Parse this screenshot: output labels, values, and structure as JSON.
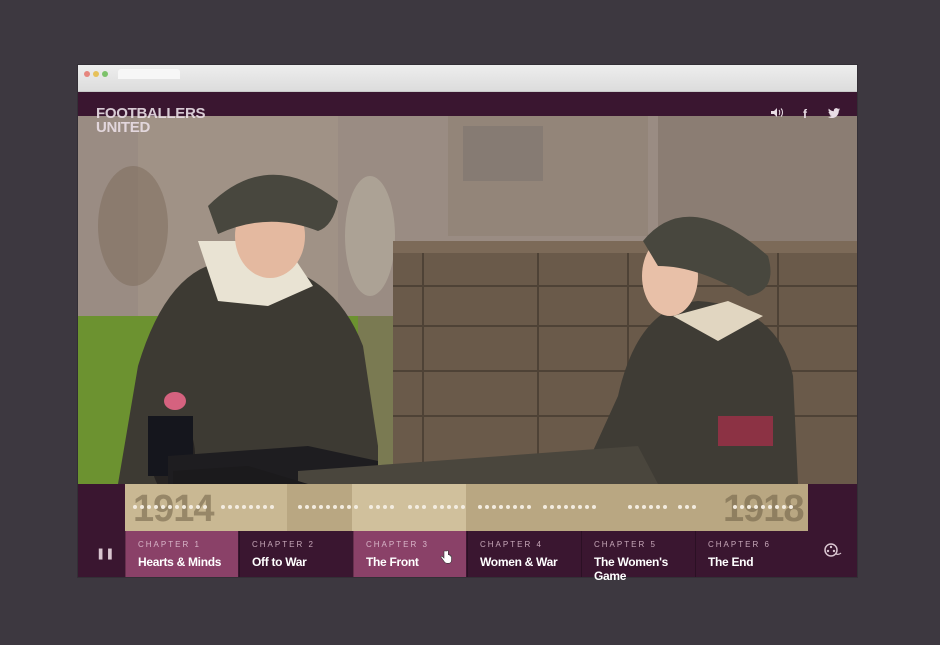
{
  "site": {
    "logo_line1": "FOOTBALLERS",
    "logo_line2": "UNITED"
  },
  "icons": {
    "sound": "speaker-icon",
    "facebook": "facebook-icon",
    "twitter": "twitter-icon",
    "pause": "pause-icon",
    "film": "film-reel-icon"
  },
  "timeline": {
    "start_year": "1914",
    "end_year": "1918"
  },
  "chapters": [
    {
      "num": "CHAPTER 1",
      "name": "Hearts & Minds"
    },
    {
      "num": "CHAPTER 2",
      "name": "Off to War"
    },
    {
      "num": "CHAPTER 3",
      "name": "The Front"
    },
    {
      "num": "CHAPTER 4",
      "name": "Women & War"
    },
    {
      "num": "CHAPTER 5",
      "name": "The Women's Game"
    },
    {
      "num": "CHAPTER 6",
      "name": "The End"
    }
  ],
  "colors": {
    "accent": "#8a4168",
    "background": "#3a1630",
    "track": "#b9a782"
  }
}
